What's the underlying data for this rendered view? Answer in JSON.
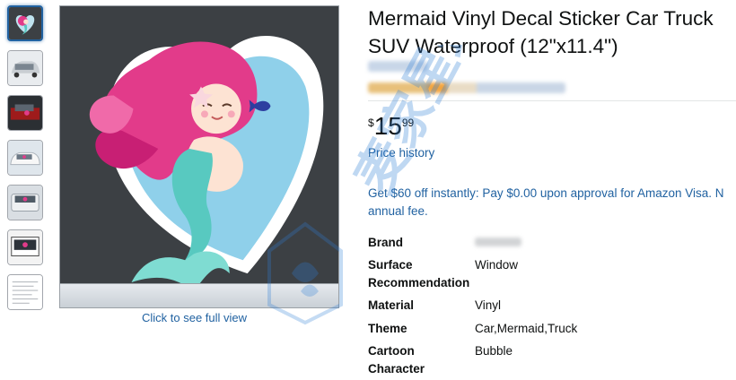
{
  "product": {
    "title_line1": "Mermaid Vinyl Decal Sticker Car Truck",
    "title_line2": "SUV Waterproof (12\"x11.4\")"
  },
  "gallery": {
    "thumbnails": [
      "mermaid",
      "car-rear",
      "car-red",
      "car-white",
      "car-rear-2",
      "truck-window",
      "instructions"
    ],
    "full_view_label": "Click to see full view"
  },
  "price": {
    "currency": "$",
    "whole": "15",
    "fraction": "99",
    "history_link": "Price history"
  },
  "promo": {
    "line1": "Get $60 off instantly: Pay $0.00 upon approval for Amazon Visa. N",
    "line2": "annual fee."
  },
  "specs": [
    {
      "label_lines": [
        "Brand"
      ],
      "value": ""
    },
    {
      "label_lines": [
        "Surface",
        "Recommendation"
      ],
      "value": "Window"
    },
    {
      "label_lines": [
        "Material"
      ],
      "value": "Vinyl"
    },
    {
      "label_lines": [
        "Theme"
      ],
      "value": "Car,Mermaid,Truck"
    },
    {
      "label_lines": [
        "Cartoon",
        "Character"
      ],
      "value": "Bubble"
    }
  ],
  "watermark": {
    "text": "麦家星球"
  },
  "colors": {
    "link": "#2162a1",
    "text": "#0f1111",
    "image_bg": "#3c4044"
  }
}
